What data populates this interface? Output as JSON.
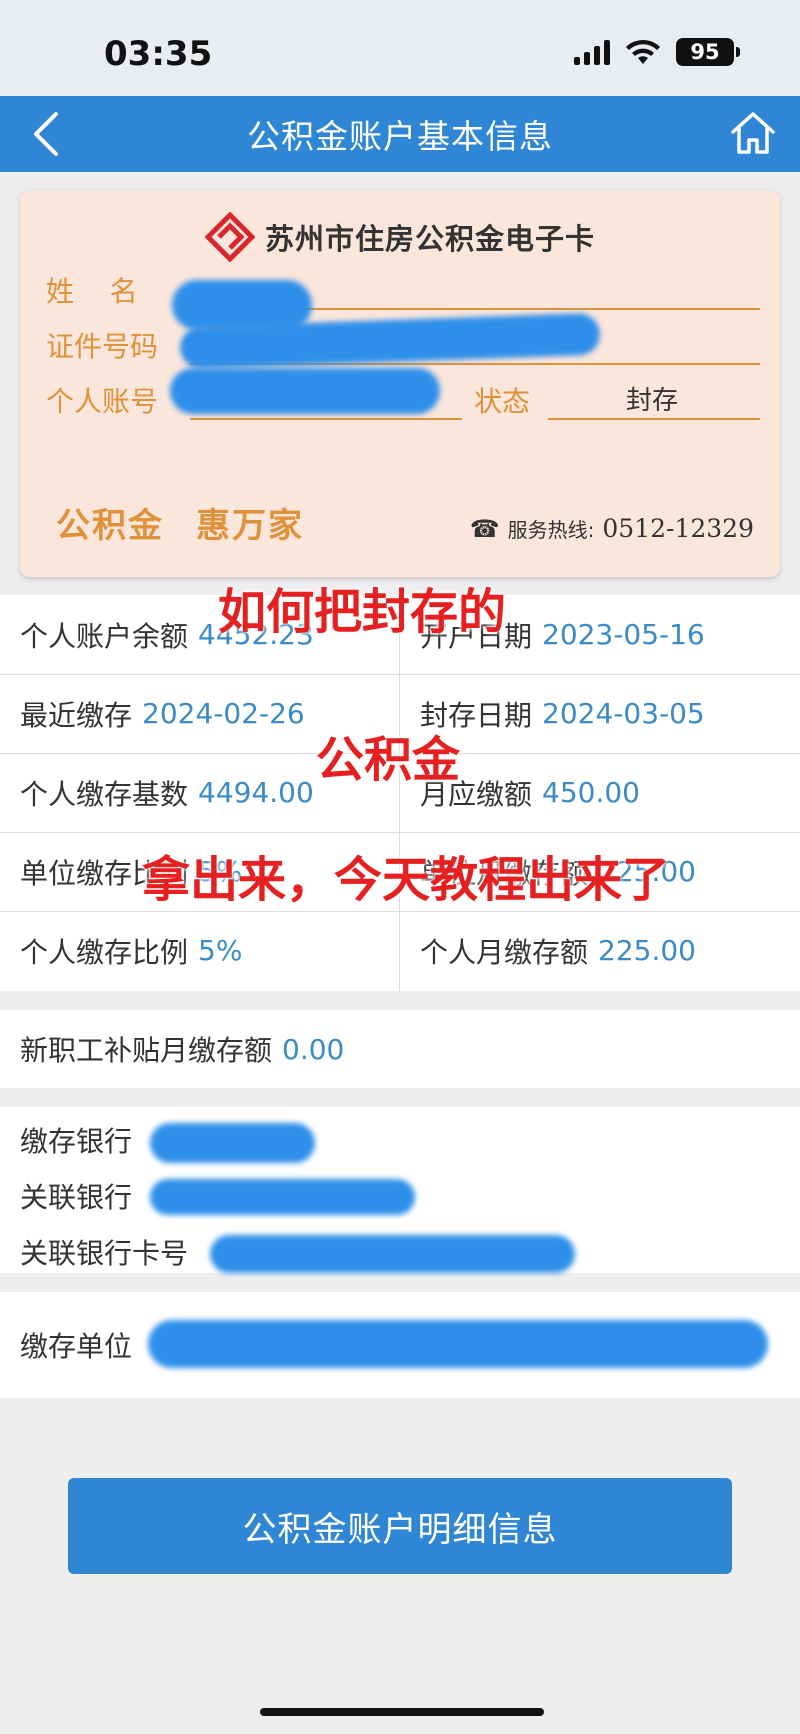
{
  "status_bar": {
    "time": "03:35",
    "battery": "95"
  },
  "nav": {
    "title": "公积金账户基本信息",
    "back_icon": "chevron-left-icon",
    "home_icon": "home-icon"
  },
  "card": {
    "title": "苏州市住房公积金电子卡",
    "labels": {
      "name": "姓    名",
      "id_number": "证件号码",
      "account": "个人账号",
      "status": "状态"
    },
    "status_value": "封存",
    "slogan_1": "公积金",
    "slogan_2": "惠万家",
    "hotline_label": "服务热线:",
    "hotline_number": "0512-12329"
  },
  "info_grid": [
    {
      "label": "个人账户余额",
      "value": "4452.23"
    },
    {
      "label": "开户日期",
      "value": "2023-05-16"
    },
    {
      "label": "最近缴存",
      "value": "2024-02-26"
    },
    {
      "label": "封存日期",
      "value": "2024-03-05"
    },
    {
      "label": "个人缴存基数",
      "value": "4494.00"
    },
    {
      "label": "月应缴额",
      "value": "450.00"
    },
    {
      "label": "单位缴存比例",
      "value": "5%"
    },
    {
      "label": "单位月缴存额",
      "value": "225.00"
    },
    {
      "label": "个人缴存比例",
      "value": "5%"
    },
    {
      "label": "个人月缴存额",
      "value": "225.00"
    }
  ],
  "subsidy": {
    "label": "新职工补贴月缴存额",
    "value": "0.00"
  },
  "bank": {
    "deposit_bank_label": "缴存银行",
    "linked_bank_label": "关联银行",
    "linked_card_label": "关联银行卡号"
  },
  "unit": {
    "label": "缴存单位"
  },
  "overlay_text": {
    "line1": "如何把封存的",
    "line2": "公积金",
    "line3": "拿出来，今天教程出来了"
  },
  "detail_button": {
    "label": "公积金账户明细信息"
  },
  "colors": {
    "nav_blue": "#2f86d4",
    "button_blue": "#2f86d4",
    "status_bar_bg": "#e9ecf1",
    "card_bg": "#fbe6dc",
    "label_orange": "#e0923a",
    "value_blue": "#3a8bc7",
    "overlay_red": "#e62020",
    "logo_red": "#d9262c",
    "redact_blue": "#2e8fea"
  }
}
